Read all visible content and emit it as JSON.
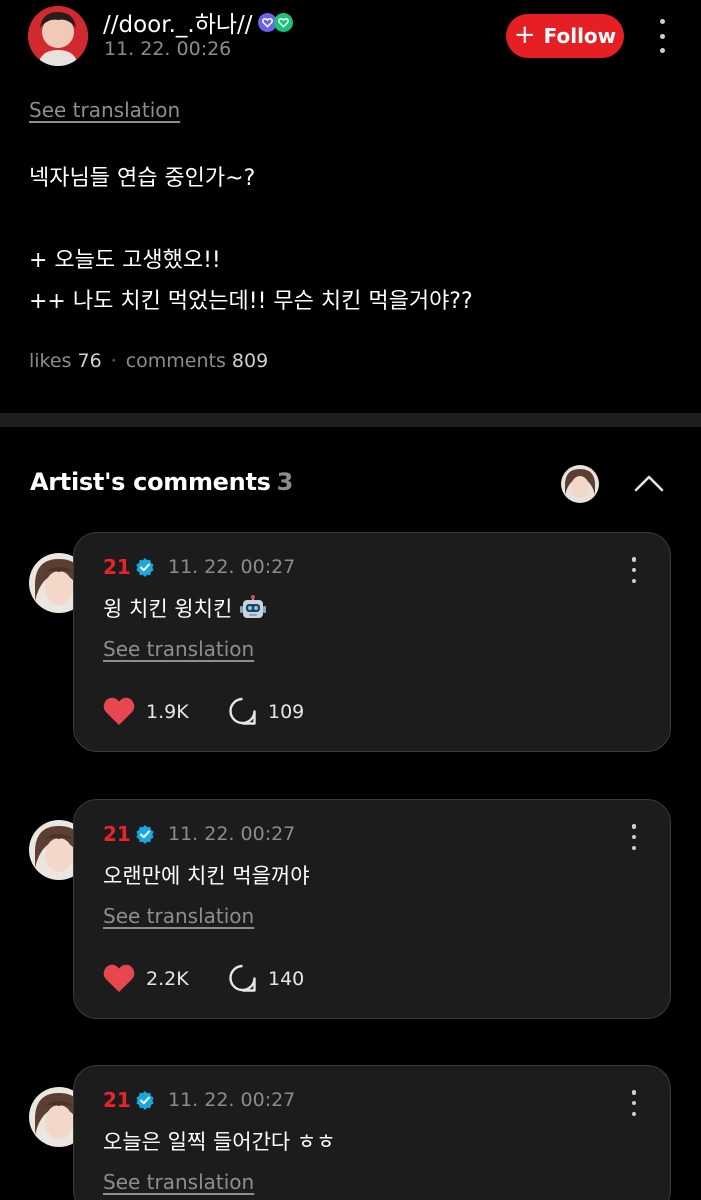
{
  "post": {
    "author_name": "//door._.하나//",
    "timestamp": "11. 22. 00:26",
    "follow_label": "Follow",
    "see_translation": "See translation",
    "lines": [
      "넥자님들 연습 중인가~?",
      "",
      "+ 오늘도 고생했오!!",
      "++ 나도 치킨 먹었는데!! 무슨 치킨 먹을거야??"
    ],
    "likes_label": "likes",
    "likes_count": "76",
    "comments_label": "comments",
    "comments_count": "809"
  },
  "artist_comments": {
    "title": "Artist's comments",
    "count": "3",
    "items": [
      {
        "author": "21",
        "timestamp": "11. 22. 00:27",
        "text": "윙 치킨 윙치킨",
        "emoji": "robot-face",
        "see_translation": "See translation",
        "likes": "1.9K",
        "replies": "109"
      },
      {
        "author": "21",
        "timestamp": "11. 22. 00:27",
        "text": "오랜만에 치킨 먹을꺼야",
        "see_translation": "See translation",
        "likes": "2.2K",
        "replies": "140"
      },
      {
        "author": "21",
        "timestamp": "11. 22. 00:27",
        "text": "오늘은 일찍 들어간다 ㅎㅎ",
        "see_translation": "See translation"
      }
    ]
  },
  "colors": {
    "background": "#000000",
    "accent_red": "#e51f24",
    "card": "#1c1c1c",
    "muted": "#8c8c8c",
    "verified_blue": "#1da1f2"
  }
}
